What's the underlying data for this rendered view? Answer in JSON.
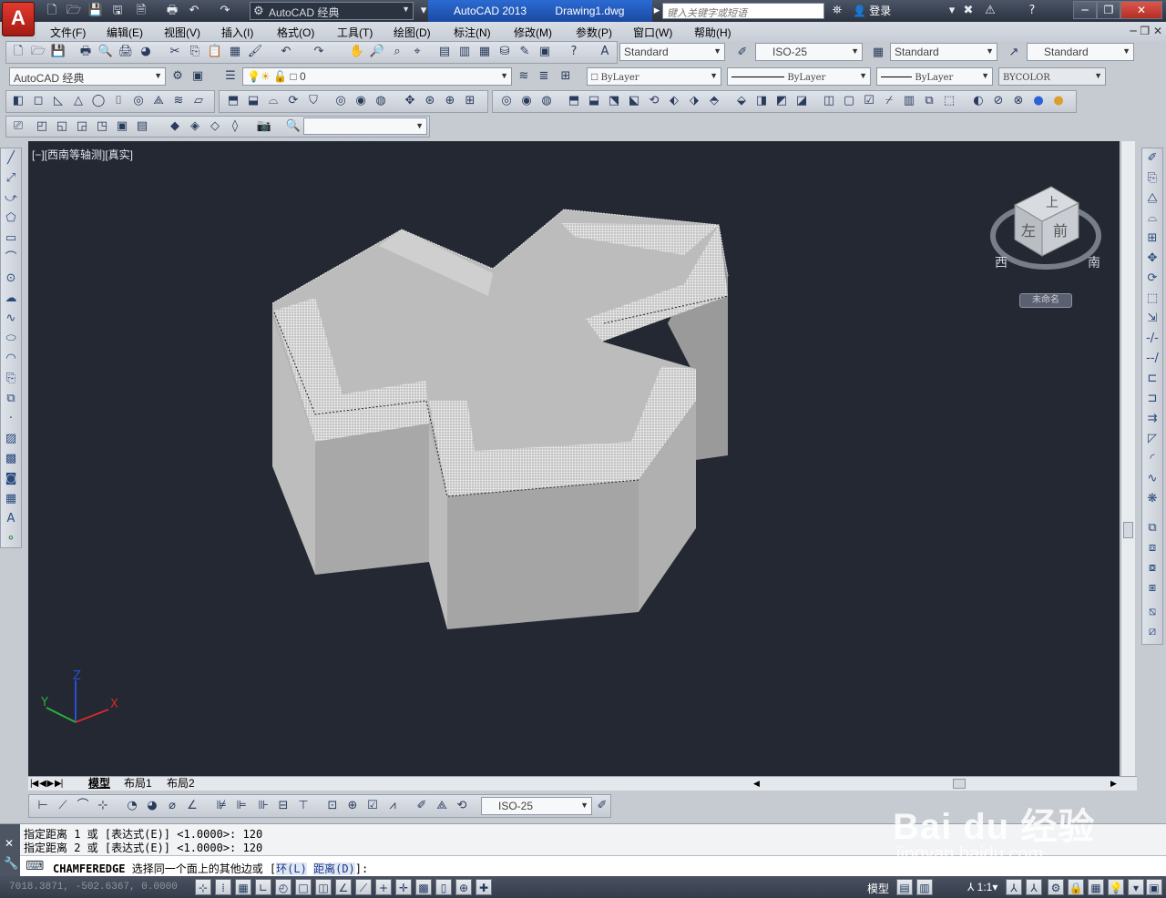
{
  "titlebar": {
    "workspace": "AutoCAD 经典",
    "app_name": "AutoCAD 2013",
    "file_name": "Drawing1.dwg",
    "search_placeholder": "键入关键字或短语",
    "login": "登录"
  },
  "menu": [
    "文件(F)",
    "编辑(E)",
    "视图(V)",
    "插入(I)",
    "格式(O)",
    "工具(T)",
    "绘图(D)",
    "标注(N)",
    "修改(M)",
    "参数(P)",
    "窗口(W)",
    "帮助(H)"
  ],
  "styles": {
    "text_style": "Standard",
    "dim_style": "ISO-25",
    "table_style": "Standard",
    "mleader_style": "Standard"
  },
  "layers": {
    "workspace2": "AutoCAD 经典",
    "current_layer": "0",
    "color": "ByLayer",
    "linetype": "ByLayer",
    "lineweight": "ByLayer",
    "plotstyle": "BYCOLOR"
  },
  "viewport": {
    "label": "[−][西南等轴测][真实]",
    "viewcube": {
      "top": "上",
      "left": "左",
      "front": "前",
      "south": "南",
      "west": "西"
    },
    "wcs": "未命名"
  },
  "tabs": [
    "模型",
    "布局1",
    "布局2"
  ],
  "dim_toolbar": {
    "dim_style": "ISO-25"
  },
  "command": {
    "history": [
      "指定距离 1 或 [表达式(E)] <1.0000>: 120",
      "指定距离 2 或 [表达式(E)] <1.0000>: 120"
    ],
    "current_cmd": "CHAMFEREDGE",
    "prompt": " 选择同一个面上的其他边或 [",
    "opt1": "环(L)",
    "opt2": "距离(D)",
    "tail": "]:"
  },
  "statusbar": {
    "coords": "7018.3871, -502.6367, 0.0000",
    "model": "模型",
    "scale": "1:1"
  },
  "watermark": {
    "brand": "Bai du 经验",
    "url": "jingyan.baidu.com"
  },
  "colors": {
    "viewport_bg": "#232833",
    "app_red": "#e23a30",
    "solid_face": "#b5b5b5"
  }
}
